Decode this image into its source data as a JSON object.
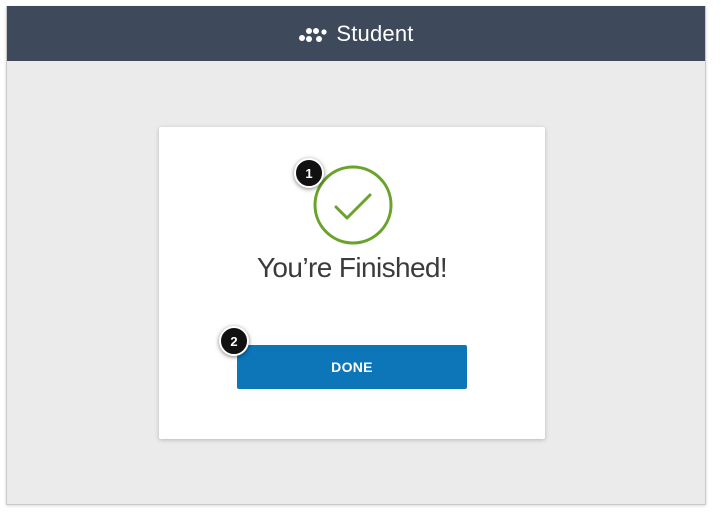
{
  "header": {
    "brand_title": "Student",
    "logo_icon": "dots-cluster-logo-icon",
    "background_color": "#3e4a5b"
  },
  "card": {
    "status_icon": "check-circle-icon",
    "status_color": "#6aa32b",
    "heading": "You’re Finished!",
    "done_label": "DONE",
    "button_color": "#0d76b8"
  },
  "callouts": [
    {
      "number": "1"
    },
    {
      "number": "2"
    }
  ]
}
